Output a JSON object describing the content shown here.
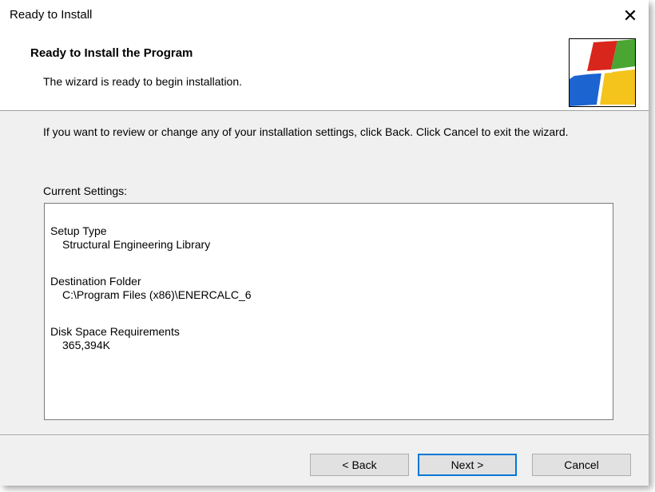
{
  "window": {
    "title": "Ready to Install",
    "close_glyph": "✕"
  },
  "banner": {
    "heading": "Ready to Install the Program",
    "subheading": "The wizard is ready to begin installation.",
    "logo_icon": "windows-installer-logo-icon"
  },
  "content": {
    "intro": "If you want to review or change any of your installation settings, click Back. Click Cancel to exit the wizard.",
    "settings_label": "Current Settings:",
    "settings": [
      {
        "label": "Setup Type",
        "value": "Structural Engineering Library"
      },
      {
        "label": "Destination Folder",
        "value": "C:\\Program Files (x86)\\ENERCALC_6"
      },
      {
        "label": "Disk Space Requirements",
        "value": "365,394K"
      }
    ]
  },
  "buttons": {
    "back": "< Back",
    "next": "Next >",
    "cancel": "Cancel"
  },
  "colors": {
    "dialog_bg": "#f0f0f0",
    "banner_bg": "#ffffff",
    "default_button_border": "#0078d7",
    "logo_red": "#d9261c",
    "logo_green": "#4aa533",
    "logo_blue": "#1c64d0",
    "logo_yellow": "#f4c41c"
  }
}
